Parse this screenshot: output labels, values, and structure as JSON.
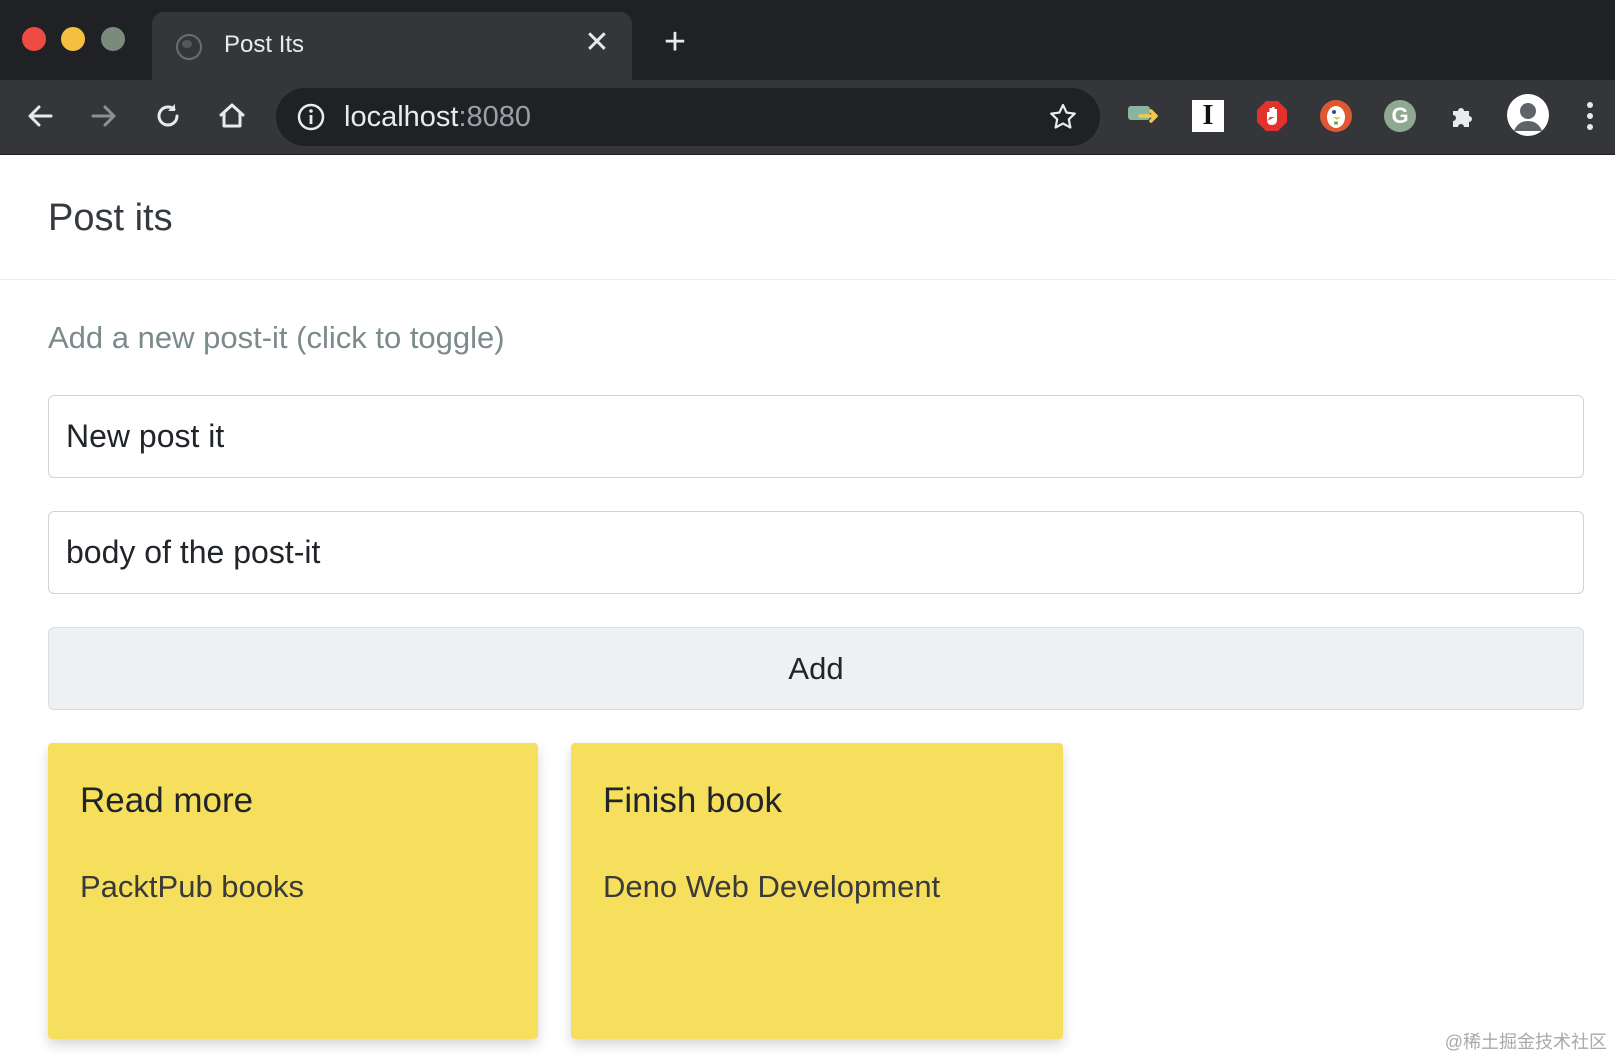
{
  "browser": {
    "tab_title": "Post Its",
    "tab_close_glyph": "✕",
    "new_tab_glyph": "+",
    "url_host": "localhost",
    "url_port": ":8080",
    "icons": [
      "back-icon",
      "forward-icon",
      "reload-icon",
      "home-icon",
      "site-info-icon",
      "bookmark-star-icon",
      "menu-icon"
    ],
    "extensions": [
      "translate-extension-icon",
      "instapaper-extension-icon",
      "adblock-extension-icon",
      "duckduckgo-extension-icon",
      "grammarly-extension-icon",
      "extensions-puzzle-icon",
      "profile-avatar"
    ],
    "extension_letters": {
      "instapaper": "I",
      "grammarly": "G"
    },
    "colors": {
      "tabstrip": "#202124",
      "toolbar": "#35363a",
      "adblock": "#e3322b",
      "duckduckgo": "#de5833",
      "grammarly": "#8fa892"
    }
  },
  "page": {
    "title": "Post its",
    "toggle_label": "Add a new post-it (click to toggle)",
    "form": {
      "title_value": "New post it",
      "body_value": "body of the post-it",
      "add_label": "Add"
    },
    "postits": [
      {
        "title": "Read more",
        "body": "PacktPub books"
      },
      {
        "title": "Finish book",
        "body": "Deno Web Development"
      }
    ],
    "colors": {
      "postit": "#f7df5e",
      "toggle_text": "#7b8a8b"
    }
  },
  "watermark": "@稀土掘金技术社区"
}
